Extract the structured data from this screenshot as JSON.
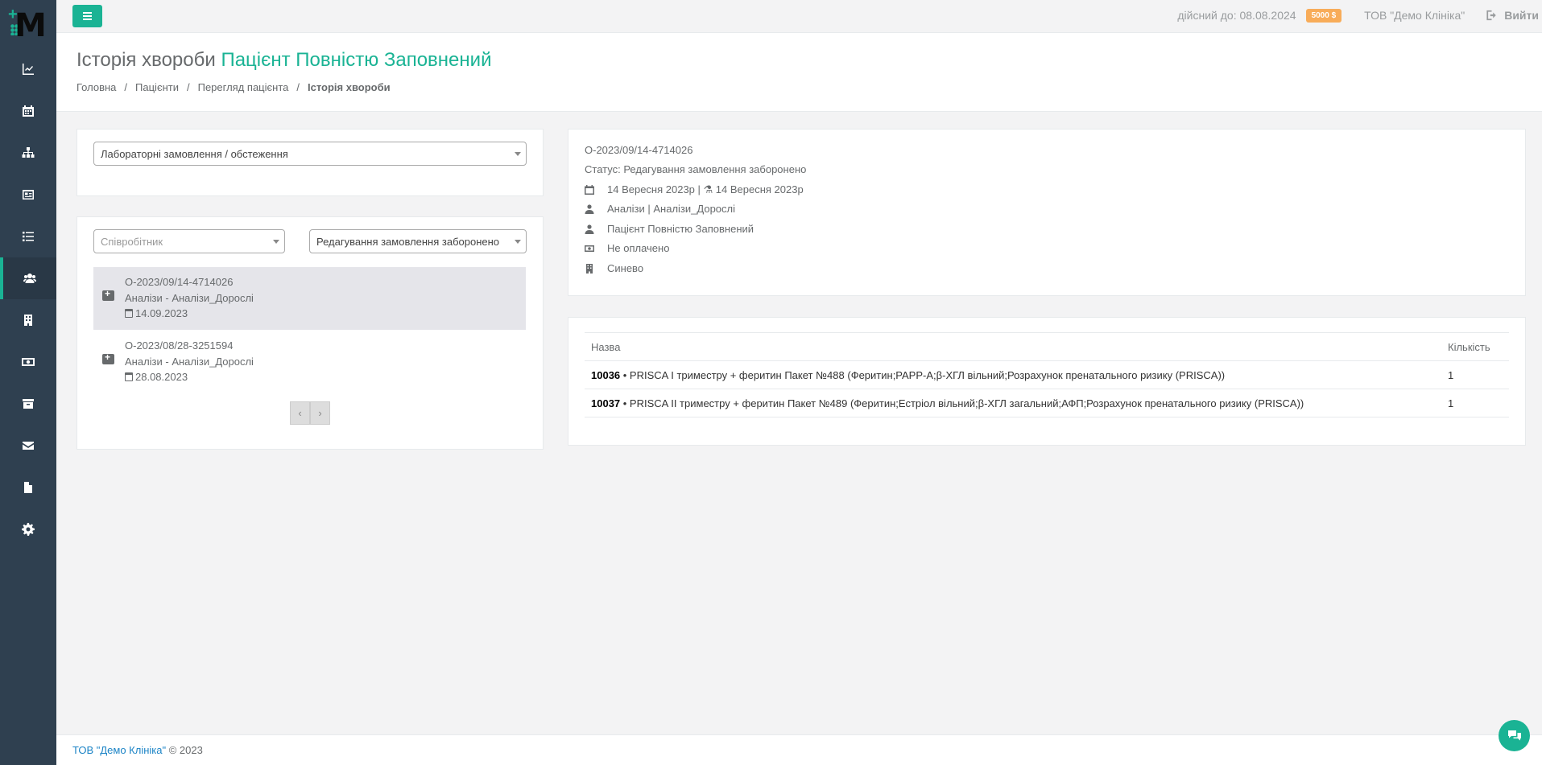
{
  "sidebar": {
    "items": [
      {
        "icon": "chart-icon"
      },
      {
        "icon": "calendar-icon"
      },
      {
        "icon": "sitemap-icon"
      },
      {
        "icon": "id-card-icon"
      },
      {
        "icon": "list-icon"
      },
      {
        "icon": "users-icon",
        "active": true
      },
      {
        "icon": "building-icon"
      },
      {
        "icon": "money-icon"
      },
      {
        "icon": "archive-icon"
      },
      {
        "icon": "envelope-icon"
      },
      {
        "icon": "file-icon"
      },
      {
        "icon": "gear-icon"
      }
    ]
  },
  "topbar": {
    "valid_until": "дійсний до: 08.08.2024",
    "balance": "5000 $",
    "clinic": "ТОВ \"Демо Клініка\"",
    "logout": "Вийти"
  },
  "heading": {
    "title_prefix": "Історія хвороби",
    "title_patient": "Пацієнт Повністю Заповнений",
    "breadcrumbs": [
      "Головна",
      "Пацієнти",
      "Перегляд пацієнта",
      "Історія хвороби"
    ]
  },
  "filters": {
    "type_select": "Лабораторні замовлення / обстеження",
    "employee_placeholder": "Співробітник",
    "status_select": "Редагування замовлення заборонено"
  },
  "orders": [
    {
      "number": "О-2023/09/14-4714026",
      "type": "Аналізи - Аналізи_Дорослі",
      "date": "14.09.2023",
      "selected": true
    },
    {
      "number": "О-2023/08/28-3251594",
      "type": "Аналізи - Аналізи_Дорослі",
      "date": "28.08.2023",
      "selected": false
    }
  ],
  "pager": {
    "prev": "‹",
    "next": "›"
  },
  "detail": {
    "number": "О-2023/09/14-4714026",
    "status": "Статус: Редагування замовлення заборонено",
    "dates": "14 Вересня 2023р | ⚗ 14 Вересня 2023р",
    "category": "Аналізи | Аналізи_Дорослі",
    "patient": "Пацієнт Повністю Заповнений",
    "payment": "Не оплачено",
    "lab": "Синево"
  },
  "items_table": {
    "headers": [
      "Назва",
      "Кількість"
    ],
    "rows": [
      {
        "code": "10036",
        "name": " • PRISCA I триместру + феритин Пакет №488 (Феритин;PAPP-A;β-ХГЛ вільний;Розрахунок пренатального ризику (PRISCA))",
        "qty": "1"
      },
      {
        "code": "10037",
        "name": " • PRISCA II триместру + феритин Пакет №489 (Феритин;Естріол вільний;β-ХГЛ загальний;АФП;Розрахунок пренатального ризику (PRISCA))",
        "qty": "1"
      }
    ]
  },
  "footer": {
    "clinic": "ТОВ \"Демо Клініка\"",
    "copyright": " © 2023"
  },
  "colors": {
    "accent": "#1ab394",
    "sidebar": "#2f4050",
    "badge": "#f8ac59",
    "link": "#1c84c6"
  }
}
